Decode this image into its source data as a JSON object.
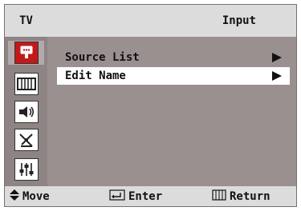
{
  "header": {
    "left_label": "TV",
    "title": "Input"
  },
  "sidebar": {
    "items": [
      {
        "name": "input",
        "icon": "input-icon",
        "active": true
      },
      {
        "name": "picture",
        "icon": "picture-icon",
        "active": false
      },
      {
        "name": "sound",
        "icon": "speaker-icon",
        "active": false
      },
      {
        "name": "channel",
        "icon": "antenna-icon",
        "active": false
      },
      {
        "name": "setup",
        "icon": "sliders-icon",
        "active": false
      }
    ]
  },
  "menu": {
    "items": [
      {
        "label": "Source List",
        "selected": false
      },
      {
        "label": "Edit Name",
        "selected": true
      }
    ]
  },
  "footer": {
    "move": "Move",
    "enter": "Enter",
    "return": "Return"
  },
  "colors": {
    "panel": "#9b9090",
    "bar": "#dcdcdc",
    "sidebar": "#8e8484",
    "active_tab": "#b2aaaa",
    "selected_row": "#ffffff",
    "input_icon": "#c21a1a"
  }
}
